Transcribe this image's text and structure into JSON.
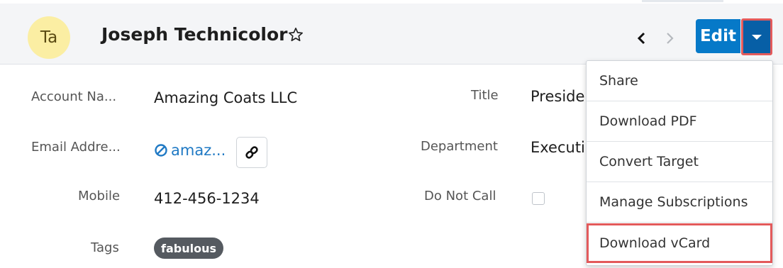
{
  "header": {
    "avatar_initials": "Ta",
    "record_name": "Joseph Technicolor",
    "edit_label": "Edit"
  },
  "fields": {
    "account_name": {
      "label": "Account Na...",
      "value": "Amazing Coats LLC"
    },
    "email": {
      "label": "Email Addre...",
      "value": "amaz..."
    },
    "mobile": {
      "label": "Mobile",
      "value": "412-456-1234"
    },
    "tags": {
      "label": "Tags",
      "value": "fabulous"
    },
    "title": {
      "label": "Title",
      "value": "Preside"
    },
    "department": {
      "label": "Department",
      "value": "Executi"
    },
    "do_not_call": {
      "label": "Do Not Call",
      "checked": false
    }
  },
  "dropdown": {
    "items": [
      "Share",
      "Download PDF",
      "Convert Target",
      "Manage Subscriptions",
      "Download vCard"
    ]
  },
  "colors": {
    "avatar_bg": "#fbeea3",
    "edit_button": "#0679c8",
    "caret_button": "#075fa6",
    "highlight_box": "#e35a5b",
    "link": "#1f79c4",
    "tag_pill": "#555a60"
  },
  "icons": [
    "star-icon",
    "chevron-left-icon",
    "chevron-right-icon",
    "caret-down-icon",
    "opt-out-icon",
    "link-icon"
  ]
}
